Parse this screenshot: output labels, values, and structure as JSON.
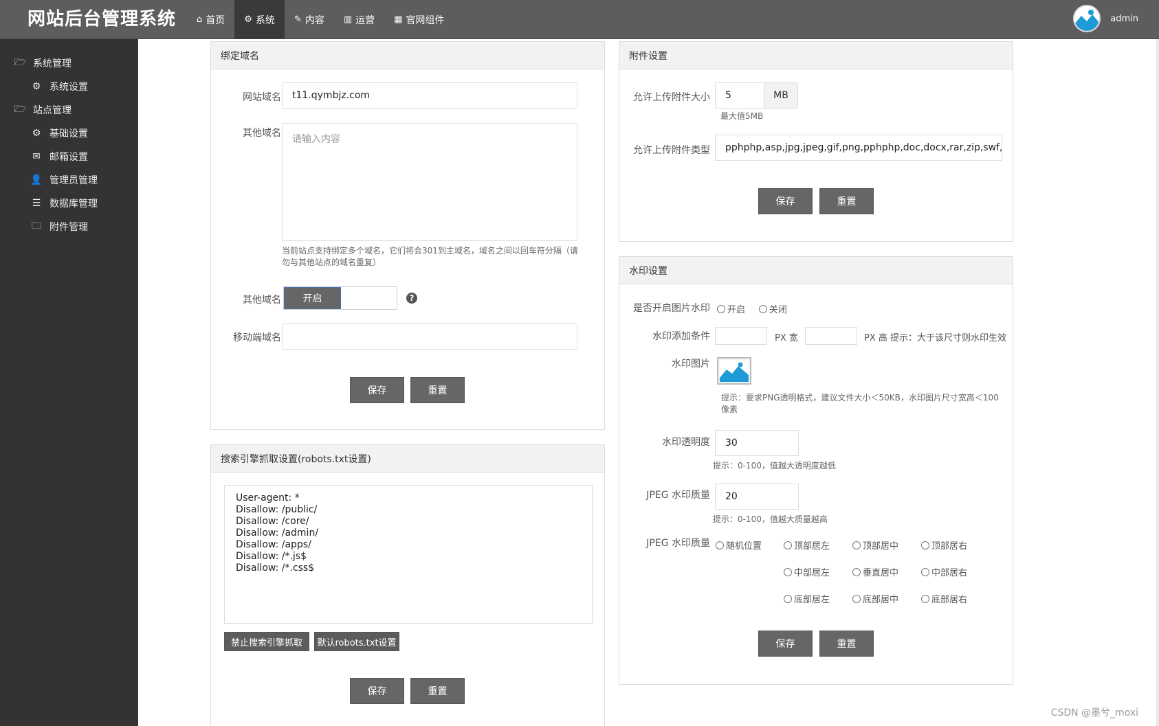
{
  "brand": "网站后台管理系统",
  "nav": [
    {
      "icon": "home-icon",
      "glyph": "⌂",
      "label": "首页"
    },
    {
      "icon": "cogs-icon",
      "glyph": "⚙",
      "label": "系统"
    },
    {
      "icon": "edit-icon",
      "glyph": "✎",
      "label": "内容"
    },
    {
      "icon": "bar-chart-icon",
      "glyph": "▥",
      "label": "运营"
    },
    {
      "icon": "table-icon",
      "glyph": "▦",
      "label": "官网组件"
    }
  ],
  "user": {
    "name": "admin"
  },
  "sidebar": {
    "group1": "系统管理",
    "item_system_settings": "系统设置",
    "group2": "站点管理",
    "items": [
      "基础设置",
      "邮箱设置",
      "管理员管理",
      "数据库管理",
      "附件管理"
    ]
  },
  "domain_panel": {
    "title": "绑定域名",
    "site_domain_label": "网站域名",
    "site_domain_value": "t11.qymbjz.com",
    "other_domain_label": "其他域名",
    "other_domain_placeholder": "请输入内容",
    "other_domain_hint": "当前站点支持绑定多个域名，它们将会301到主域名，域名之间以回车符分隔（请勿与其他站点的域名重复）",
    "other_domain_toggle_label": "其他域名",
    "toggle_on": "开启",
    "mobile_domain_label": "移动端域名",
    "save": "保存",
    "reset": "重置"
  },
  "robots_panel": {
    "title": "搜索引擎抓取设置(robots.txt设置)",
    "content": "User-agent: *\nDisallow: /public/\nDisallow: /core/\nDisallow: /admin/\nDisallow: /apps/\nDisallow: /*.js$\nDisallow: /*.css$",
    "block_button": "禁止搜索引擎抓取",
    "default_button": "默认robots.txt设置",
    "save": "保存",
    "reset": "重置"
  },
  "attach_panel": {
    "title": "附件设置",
    "size_label": "允许上传附件大小",
    "size_value": "5",
    "size_unit": "MB",
    "size_hint": "最大值5MB",
    "type_label": "允许上传附件类型",
    "type_value": "pphphp,asp,jpg,jpeg,gif,png,pphphp,doc,docx,rar,zip,swf,pdf,",
    "save": "保存",
    "reset": "重置"
  },
  "watermark_panel": {
    "title": "水印设置",
    "enable_label": "是否开启图片水印",
    "enable_on": "开启",
    "enable_off": "关闭",
    "cond_label": "水印添加条件",
    "px_width": "PX 宽",
    "px_height": "PX 高 提示：大于该尺寸则水印生效",
    "image_label": "水印图片",
    "image_hint": "提示：要求PNG透明格式，建议文件大小＜50KB，水印图片尺寸宽高＜100像素",
    "opacity_label": "水印透明度",
    "opacity_value": "30",
    "opacity_hint": "提示：0-100，值越大透明度越低",
    "quality_label": "JPEG 水印质量",
    "quality_value": "20",
    "quality_hint": "提示：0-100，值越大质量越高",
    "position_label": "JPEG 水印质量",
    "positions": [
      "随机位置",
      "顶部居左",
      "顶部居中",
      "顶部居右",
      "中部居左",
      "垂直居中",
      "中部居右",
      "底部居左",
      "底部居中",
      "底部居右"
    ],
    "save": "保存",
    "reset": "重置"
  },
  "credit": "CSDN @墨兮_moxi"
}
